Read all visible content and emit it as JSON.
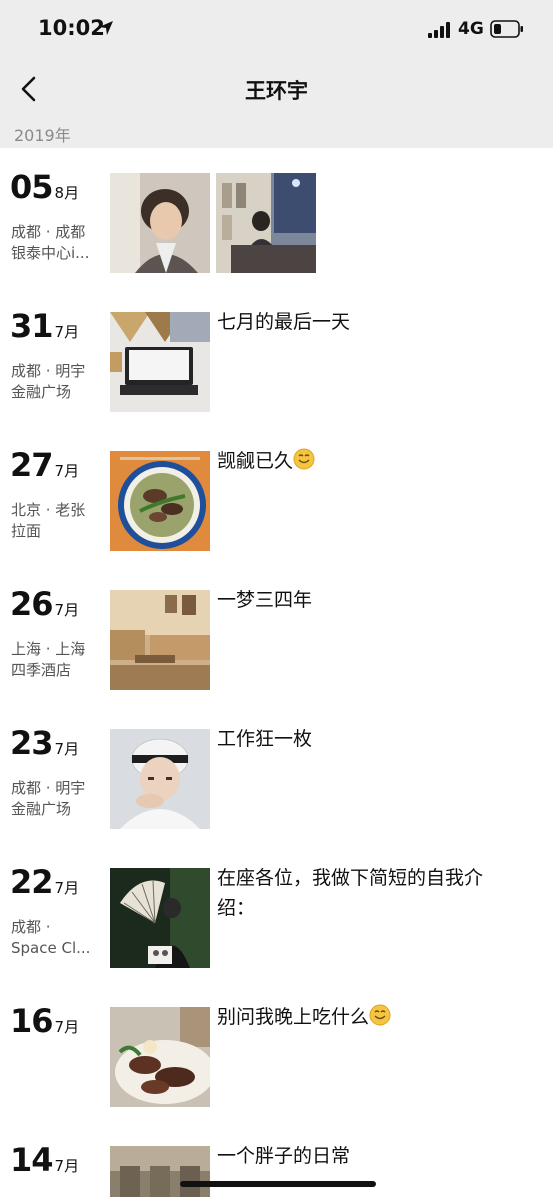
{
  "status": {
    "time": "10:02",
    "network": "4G"
  },
  "header": {
    "title": "王环宇"
  },
  "year": "2019年",
  "posts": [
    {
      "day": "05",
      "month": "8月",
      "loc1": "成都 · 成都",
      "loc2": "银泰中心i...",
      "caption": ""
    },
    {
      "day": "31",
      "month": "7月",
      "loc1": "成都 · 明宇",
      "loc2": "金融广场",
      "caption": "七月的最后一天"
    },
    {
      "day": "27",
      "month": "7月",
      "loc1": "北京 · 老张",
      "loc2": "拉面",
      "caption": "觊觎已久"
    },
    {
      "day": "26",
      "month": "7月",
      "loc1": "上海 · 上海",
      "loc2": "四季酒店",
      "caption": "一梦三四年"
    },
    {
      "day": "23",
      "month": "7月",
      "loc1": "成都 · 明宇",
      "loc2": "金融广场",
      "caption": "工作狂一枚"
    },
    {
      "day": "22",
      "month": "7月",
      "loc1": "成都 ·",
      "loc2": "Space Cl...",
      "caption": "在座各位，我做下简短的自我介绍："
    },
    {
      "day": "16",
      "month": "7月",
      "loc1": "",
      "loc2": "",
      "caption": "别问我晚上吃什么"
    },
    {
      "day": "14",
      "month": "7月",
      "loc1": "",
      "loc2": "",
      "caption": "一个胖子的日常"
    }
  ],
  "icons": {
    "back": "chevron-left-icon",
    "location": "location-arrow-icon",
    "signal": "signal-bars-icon",
    "battery": "battery-icon",
    "emoji": "smile-emoji-icon"
  },
  "colors": {
    "bar_bg": "#ededed",
    "year_text": "#8a8a8a",
    "emoji": "#f5c542"
  }
}
